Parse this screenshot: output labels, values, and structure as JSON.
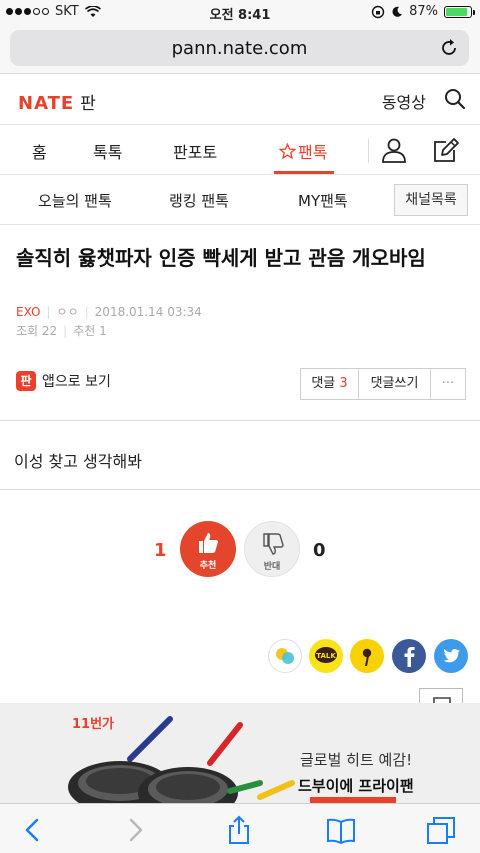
{
  "status_bar": {
    "carrier": "SKT",
    "time": "오전 8:41",
    "battery": "87%",
    "battery_level": 0.87
  },
  "browser": {
    "url": "pann.nate.com"
  },
  "header": {
    "logo_nate": "NATE",
    "logo_pan": "판",
    "video_label": "동영상"
  },
  "nav_primary": {
    "items": [
      "홈",
      "톡톡",
      "판포토",
      "팬톡"
    ],
    "active_index": 3
  },
  "nav_secondary": {
    "items": [
      "오늘의 팬톡",
      "랭킹 팬톡",
      "MY팬톡"
    ],
    "channel_button": "채널목록"
  },
  "article": {
    "title": "솔직히 윯챗파자 인증 빡세게 받고 관음 개오바임",
    "category": "EXO",
    "author": "ㅇㅇ",
    "datetime": "2018.01.14 03:34",
    "views": "조회 22",
    "recommend": "추천 1",
    "body": "이성 찾고 생각해봐"
  },
  "actions": {
    "app_view_icon": "판",
    "app_view_label": "앱으로 보기",
    "comments_label": "댓글",
    "comments_count": "3",
    "write_comment_label": "댓글쓰기",
    "more_label": "···"
  },
  "vote": {
    "up_count": "1",
    "up_label": "추천",
    "down_count": "0",
    "down_label": "반대"
  },
  "share": {
    "talk_label": "TALK"
  },
  "ad": {
    "brand": "11번가",
    "line1": "글로벌 히트 예감!",
    "line2": "드부이에 프라이팬"
  },
  "colors": {
    "accent": "#e8412c",
    "kakao": "#f7e317",
    "facebook": "#3b5998",
    "twitter": "#3d9be9"
  }
}
